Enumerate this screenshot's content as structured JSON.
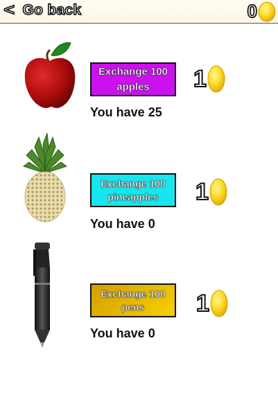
{
  "header": {
    "back_icon": "<",
    "back_label": "Go back",
    "balance": "0",
    "coin_icon": "gold-coin-icon"
  },
  "items": [
    {
      "icon": "apple-icon",
      "button_label": "Exchange 100 apples",
      "button_color": "#cc11ee",
      "reward": "1",
      "have_prefix": "You have",
      "have_count": "25"
    },
    {
      "icon": "pineapple-icon",
      "button_label": "Exchange 100 pineapples",
      "button_color": "#16e6ee",
      "reward": "1",
      "have_prefix": "You have",
      "have_count": "0"
    },
    {
      "icon": "pen-icon",
      "button_label": "Exchange 100 pens",
      "button_color": "#e0b800",
      "reward": "1",
      "have_prefix": "You have",
      "have_count": "0"
    }
  ]
}
